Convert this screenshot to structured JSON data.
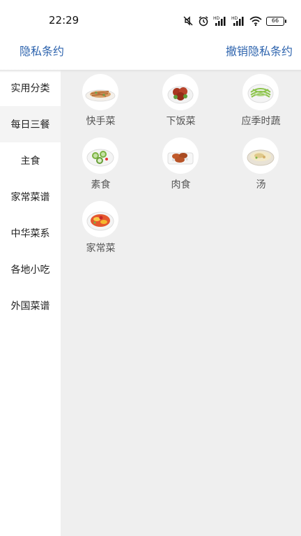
{
  "status": {
    "time": "22:29",
    "battery": "66"
  },
  "header": {
    "left_link": "隐私条约",
    "right_link": "撤销隐私条约"
  },
  "sidebar": {
    "items": [
      {
        "label": "实用分类"
      },
      {
        "label": "每日三餐"
      },
      {
        "label": "主食"
      },
      {
        "label": "家常菜谱"
      },
      {
        "label": "中华菜系"
      },
      {
        "label": "各地小吃"
      },
      {
        "label": "外国菜谱"
      }
    ],
    "selected": "实用分类"
  },
  "categories": [
    {
      "label": "快手菜",
      "icon": "stir-fry-dish-icon"
    },
    {
      "label": "下饭菜",
      "icon": "braised-meat-dish-icon"
    },
    {
      "label": "应季时蔬",
      "icon": "green-vegetable-dish-icon"
    },
    {
      "label": "素食",
      "icon": "cucumber-salad-dish-icon"
    },
    {
      "label": "肉食",
      "icon": "braised-ribs-dish-icon"
    },
    {
      "label": "汤",
      "icon": "soup-bowl-icon"
    },
    {
      "label": "家常菜",
      "icon": "tomato-egg-dish-icon"
    }
  ]
}
